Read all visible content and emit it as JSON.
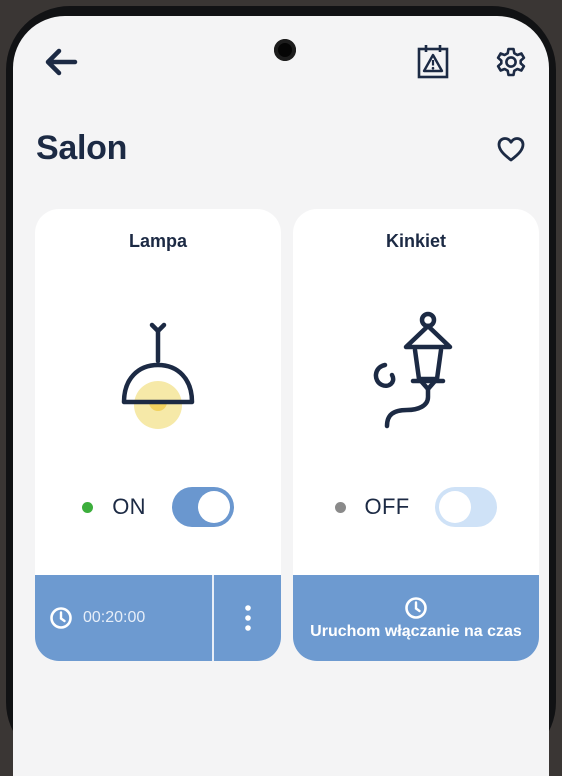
{
  "header": {
    "back_icon": "arrow-left-icon",
    "alarm_icon": "alarm-warning-icon",
    "settings_icon": "gear-icon"
  },
  "room": {
    "title": "Salon",
    "favorite_icon": "heart-outline-icon"
  },
  "devices": [
    {
      "name": "Lampa",
      "icon": "pendant-lamp-icon",
      "status": "ON",
      "status_color": "#3cae3c",
      "toggle_on": true,
      "timer": "00:20:00"
    },
    {
      "name": "Kinkiet",
      "icon": "wall-lantern-icon",
      "status": "OFF",
      "status_color": "#8a8a8a",
      "toggle_on": false,
      "schedule_label": "Uruchom włączanie na czas"
    }
  ],
  "colors": {
    "primary_dark": "#1c2a44",
    "accent_blue": "#6d9ad0",
    "toggle_off": "#cfe2f7",
    "lamp_glow": "#f6e9a8"
  }
}
